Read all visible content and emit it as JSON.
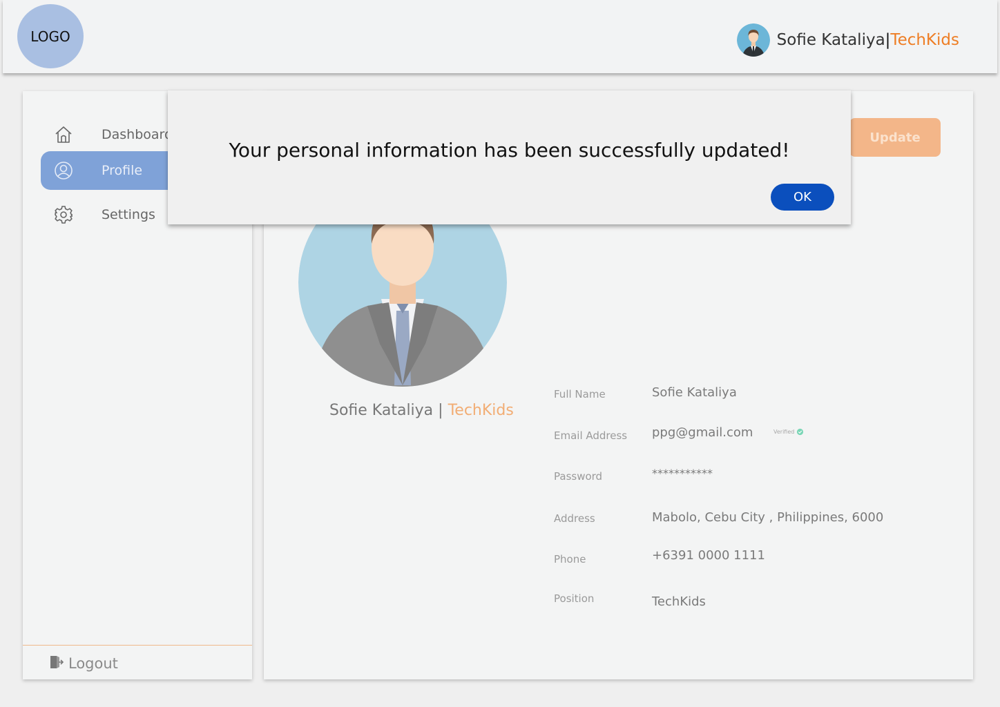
{
  "header": {
    "logo_text": "LOGO",
    "user_name": "Sofie Kataliya",
    "separator": "|",
    "org": "TechKids"
  },
  "sidebar": {
    "items": [
      {
        "label": "Dashboard",
        "icon": "home-icon",
        "active": false
      },
      {
        "label": "Profile",
        "icon": "user-circle-icon",
        "active": true
      },
      {
        "label": "Settings",
        "icon": "gear-icon",
        "active": false
      }
    ],
    "logout_label": "Logout"
  },
  "profile": {
    "update_label": "Update",
    "name": "Sofie Kataliya",
    "separator": "|",
    "org": "TechKids",
    "fields": [
      {
        "label": "Full Name",
        "value": "Sofie Kataliya"
      },
      {
        "label": "Email Address",
        "value": "ppg@gmail.com"
      },
      {
        "label": "Password",
        "value": "***********"
      },
      {
        "label": "Address",
        "value": "Mabolo, Cebu City , Philippines, 6000"
      },
      {
        "label": "Phone",
        "value": "+6391 0000 1111"
      },
      {
        "label": "Position",
        "value": "TechKids"
      }
    ],
    "verified_label": "Verified"
  },
  "modal": {
    "message": "Your personal information has been successfully updated!",
    "ok_label": "OK"
  },
  "colors": {
    "accent_orange": "#ee7d24",
    "active_nav": "#7fa2d8",
    "ok_button": "#0b4fbd",
    "logo_bg": "#a9bfe2"
  }
}
